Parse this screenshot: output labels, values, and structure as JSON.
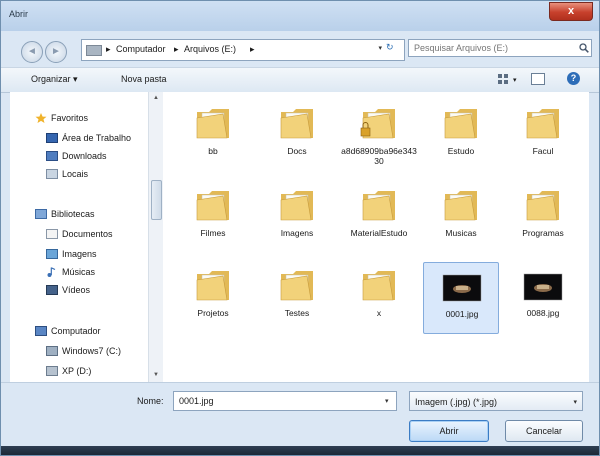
{
  "window": {
    "title": "Abrir",
    "close": "x"
  },
  "nav": {
    "back": "◄",
    "forward": "►"
  },
  "address": {
    "crumbs": [
      "Computador",
      "Arquivos (E:)"
    ],
    "separator": "▸",
    "dropdown": "▾",
    "refresh": "↻"
  },
  "search": {
    "placeholder": "Pesquisar Arquivos (E:)"
  },
  "toolbar": {
    "organize": "Organizar ▾",
    "new_folder": "Nova pasta",
    "views_drop": "▾",
    "help": "?"
  },
  "sidebar": {
    "items": [
      {
        "label": "Favoritos",
        "icon": "star-icon"
      },
      {
        "label": "Área de Trabalho",
        "icon": "desktop-icon"
      },
      {
        "label": "Downloads",
        "icon": "downloads-icon"
      },
      {
        "label": "Locais",
        "icon": "recent-places-icon"
      },
      {
        "label": "Bibliotecas",
        "icon": "libraries-icon"
      },
      {
        "label": "Documentos",
        "icon": "documents-icon"
      },
      {
        "label": "Imagens",
        "icon": "pictures-icon"
      },
      {
        "label": "Músicas",
        "icon": "music-icon"
      },
      {
        "label": "Vídeos",
        "icon": "videos-icon"
      },
      {
        "label": "Computador",
        "icon": "computer-icon"
      },
      {
        "label": "Windows7 (C:)",
        "icon": "drive-icon"
      },
      {
        "label": "XP (D:)",
        "icon": "drive-icon"
      }
    ]
  },
  "files": [
    {
      "name": "bb",
      "type": "folder"
    },
    {
      "name": "Docs",
      "type": "folder"
    },
    {
      "name": "a8d68909ba96e34330",
      "type": "folder-locked"
    },
    {
      "name": "Estudo",
      "type": "folder"
    },
    {
      "name": "Facul",
      "type": "folder"
    },
    {
      "name": "Filmes",
      "type": "folder"
    },
    {
      "name": "Imagens",
      "type": "folder"
    },
    {
      "name": "MaterialEstudo",
      "type": "folder"
    },
    {
      "name": "Musicas",
      "type": "folder"
    },
    {
      "name": "Programas",
      "type": "folder"
    },
    {
      "name": "Projetos",
      "type": "folder"
    },
    {
      "name": "Testes",
      "type": "folder"
    },
    {
      "name": "x",
      "type": "folder"
    },
    {
      "name": "0001.jpg",
      "type": "image",
      "selected": true
    },
    {
      "name": "0088.jpg",
      "type": "image"
    }
  ],
  "footer": {
    "name_label": "Nome:",
    "name_value": "0001.jpg",
    "type_value": "Imagem (.jpg) (*.jpg)",
    "open_label": "Abrir",
    "cancel_label": "Cancelar",
    "arrow": "▾"
  }
}
